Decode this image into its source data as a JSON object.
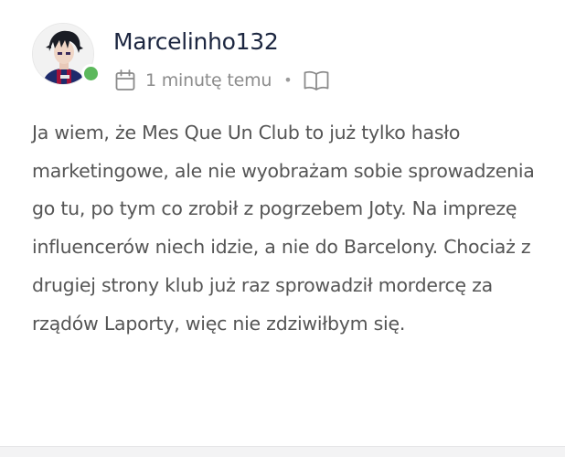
{
  "comment": {
    "author": {
      "username": "Marcelinho132",
      "avatar": "avatar-image",
      "online_status": "online",
      "status_color": "#5cb85c"
    },
    "meta": {
      "timestamp": "1 minutę temu",
      "separator": "•",
      "calendar_icon": "calendar-icon",
      "reader_icon": "open-book-icon"
    },
    "text": "Ja wiem, że Mes Que Un Club to już tylko hasło marketingowe, ale nie wyobrażam sobie sprowadzenia go tu, po tym co zrobił z pogrzebem Joty. Na imprezę influencerów niech idzie, a nie do Barcelony. Chociaż z drugiej strony klub już raz sprowadził mordercę za rządów Laporty, więc nie zdziwiłbym się."
  }
}
